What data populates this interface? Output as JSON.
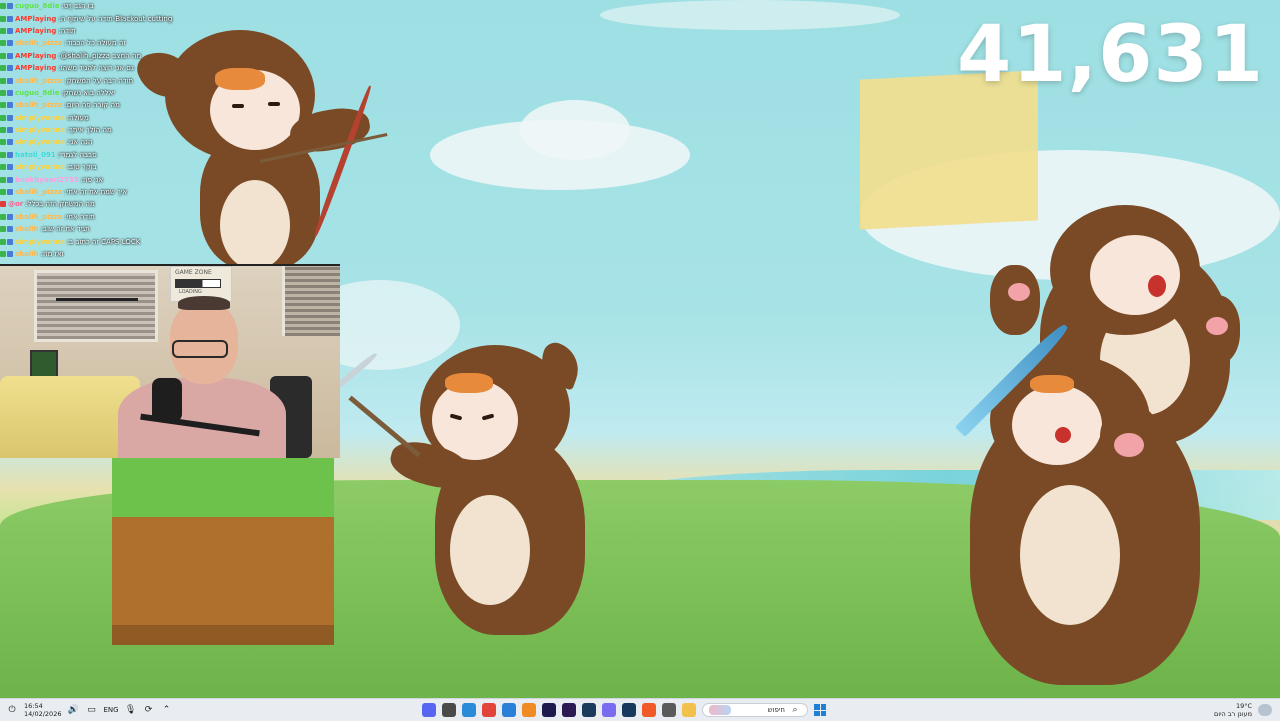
{
  "stream": {
    "counter": "41,631"
  },
  "chat": {
    "messages": [
      {
        "user": "cuguo_8die",
        "color": "#5fe24c",
        "text": "בו הגב ןיט",
        "badges": [
          "#3bb54a",
          "#4a7bd3"
        ]
      },
      {
        "user": "AMPlaying",
        "color": "#ff3b30",
        "text": "תודה על שיתוף ה-Blackout cutting",
        "badges": [
          "#3bb54a",
          "#4a7bd3"
        ]
      },
      {
        "user": "AMPlaying",
        "color": "#ff3b30",
        "text": "תודה",
        "badges": [
          "#3bb54a",
          "#4a7bd3"
        ]
      },
      {
        "user": "shalih_pizza",
        "color": "#ffb84d",
        "text": "זה מעולה כל הכבוד",
        "badges": [
          "#3bb54a",
          "#4a7bd3"
        ]
      },
      {
        "user": "AMPlaying",
        "color": "#ff3b30",
        "text": "@shalih_pizza מה המצב",
        "badges": [
          "#3bb54a",
          "#4a7bd3"
        ]
      },
      {
        "user": "AMPlaying",
        "color": "#ff3b30",
        "text": "גם אני רוצה להגיד משהו",
        "badges": [
          "#3bb54a",
          "#4a7bd3"
        ]
      },
      {
        "user": "shalih_pizza",
        "color": "#ffb84d",
        "text": "תודה רבה על המשחק",
        "badges": [
          "#3bb54a",
          "#4a7bd3"
        ]
      },
      {
        "user": "cuguo_8die",
        "color": "#5fe24c",
        "text": "יאללה בוא נשחק",
        "badges": [
          "#3bb54a",
          "#4a7bd3"
        ]
      },
      {
        "user": "shalih_pizza",
        "color": "#ffb84d",
        "text": "מה קורה פה היום",
        "badges": [
          "#3bb54a",
          "#4a7bd3"
        ]
      },
      {
        "user": "simplyvanna",
        "color": "#ffd23b",
        "text": "מעולה",
        "badges": [
          "#3bb54a",
          "#4a7bd3"
        ]
      },
      {
        "user": "simplyvanna",
        "color": "#ffd23b",
        "text": "מה הולך איתך",
        "badges": [
          "#3bb54a",
          "#4a7bd3"
        ]
      },
      {
        "user": "simplyvanna",
        "color": "#ffd23b",
        "text": "הנה אני",
        "badges": [
          "#3bb54a",
          "#4a7bd3"
        ]
      },
      {
        "user": "hatoli_091",
        "color": "#3ddbd9",
        "text": "סבבה לגמרי",
        "badges": [
          "#3bb54a",
          "#4a7bd3"
        ]
      },
      {
        "user": "simplyvanna",
        "color": "#ffd23b",
        "text": "בוקר טוב",
        "badges": [
          "#3bb54a",
          "#4a7bd3"
        ]
      },
      {
        "user": "bookbyaari2735",
        "color": "#ff9ee0",
        "text": "אני פה",
        "badges": [
          "#3bb54a",
          "#4a7bd3"
        ]
      },
      {
        "user": "shalih_pizza",
        "color": "#ffb84d",
        "text": "איך שמת את זה אחי",
        "badges": [
          "#3bb54a",
          "#4a7bd3"
        ]
      },
      {
        "user": "@or",
        "color": "#ff5c8a",
        "text": "מה המשחק הזה בכלל",
        "badges": [
          "#e23b3b"
        ]
      },
      {
        "user": "shalih_pizza",
        "color": "#ffb84d",
        "text": "תודה אחי",
        "badges": [
          "#3bb54a",
          "#4a7bd3"
        ]
      },
      {
        "user": "shalih",
        "color": "#ffb84d",
        "text": "תגיד את זה שוב",
        "badges": [
          "#3bb54a",
          "#4a7bd3"
        ]
      },
      {
        "user": "simplyvanna",
        "color": "#ffd23b",
        "text": "זה כתוב ב CAPS LOCK",
        "badges": [
          "#3bb54a",
          "#4a7bd3"
        ]
      },
      {
        "user": "shalih",
        "color": "#ffb84d",
        "text": "ואז מה",
        "badges": [
          "#3bb54a",
          "#4a7bd3"
        ]
      }
    ]
  },
  "webcam": {
    "poster_title": "GAME ZONE",
    "poster_sub": "LOADING"
  },
  "taskbar": {
    "time": "16:54",
    "date": "14/02/2026",
    "lang": "ENG",
    "search_text": "חיפוש",
    "weather_temp": "19°C",
    "weather_desc": "מעונן רב היום",
    "apps": [
      {
        "name": "discord-app",
        "color": "#5865f2"
      },
      {
        "name": "file-explorer-app",
        "color": "#4a4a4a"
      },
      {
        "name": "browser-app",
        "color": "#2a8bd6"
      },
      {
        "name": "media-app",
        "color": "#e0443a"
      },
      {
        "name": "notepad-app",
        "color": "#2a7fd6"
      },
      {
        "name": "blender-app",
        "color": "#f08a24"
      },
      {
        "name": "after-effects-app",
        "color": "#1f1a4d"
      },
      {
        "name": "premiere-app",
        "color": "#2b1a52"
      },
      {
        "name": "photoshop-app",
        "color": "#1c3a5c"
      },
      {
        "name": "discord-active-app",
        "color": "#7a6cf0"
      },
      {
        "name": "steam-app",
        "color": "#173a5c"
      },
      {
        "name": "brave-app",
        "color": "#f05a28"
      },
      {
        "name": "calculator-app",
        "color": "#5a5a5a"
      },
      {
        "name": "folder-app",
        "color": "#f2c14b"
      }
    ]
  }
}
